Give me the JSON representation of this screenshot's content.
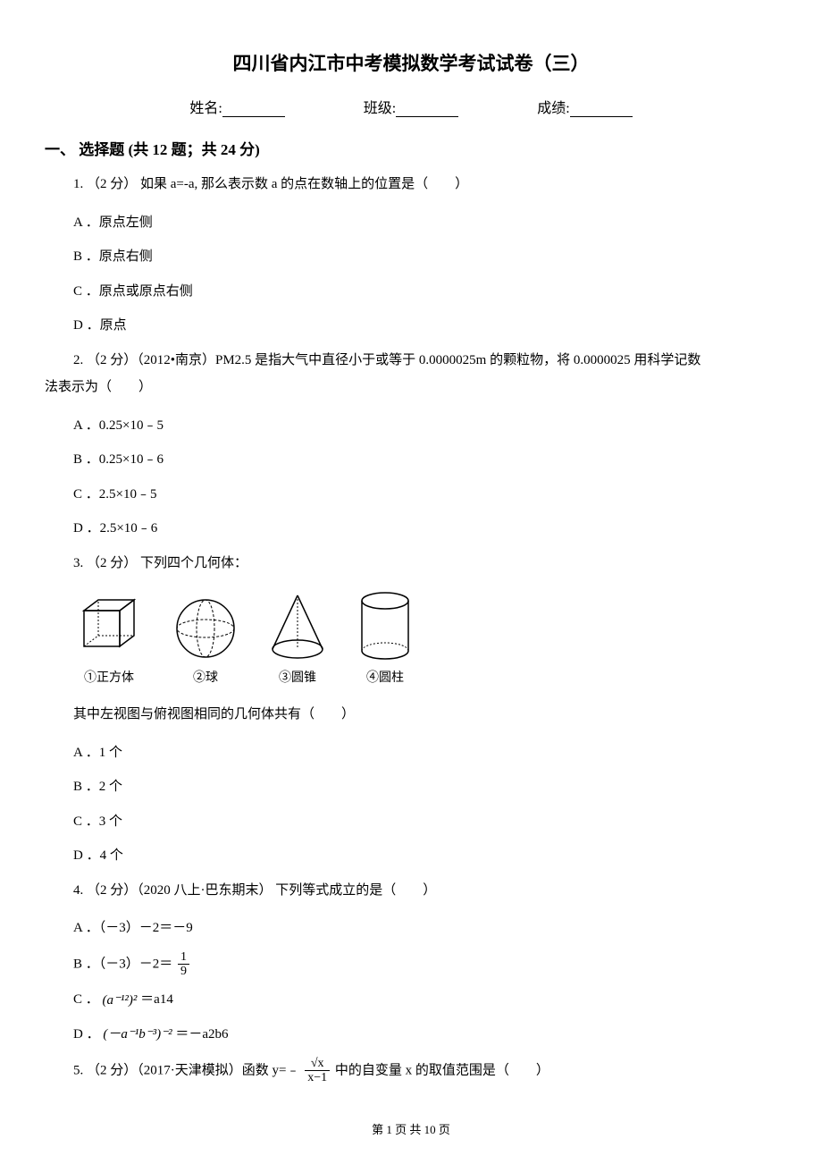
{
  "title": "四川省内江市中考模拟数学考试试卷（三）",
  "info": {
    "name_label": "姓名:",
    "class_label": "班级:",
    "score_label": "成绩:"
  },
  "section1": {
    "header": "一、 选择题 (共 12 题；共 24 分)"
  },
  "q1": {
    "stem": "1.  （2 分） 如果 a=-a, 那么表示数 a 的点在数轴上的位置是（　　）",
    "a": "A ．原点左侧",
    "b": "B ．原点右侧",
    "c": "C ．原点或原点右侧",
    "d": "D ．原点"
  },
  "q2": {
    "stem": "2.  （2 分）（2012•南京）PM2.5 是指大气中直径小于或等于 0.0000025m 的颗粒物，将 0.0000025 用科学记数",
    "stem2": "法表示为（　　）",
    "a": "A ．0.25×10﹣5",
    "b": "B ．0.25×10﹣6",
    "c": "C ．2.5×10﹣5",
    "d": "D ．2.5×10﹣6"
  },
  "q3": {
    "stem": "3.  （2 分） 下列四个几何体：",
    "shapes": {
      "s1": "①正方体",
      "s2": "②球",
      "s3": "③圆锥",
      "s4": "④圆柱"
    },
    "stem2": "其中左视图与俯视图相同的几何体共有（　　）",
    "a": "A ．1 个",
    "b": "B ．2 个",
    "c": "C ．3 个",
    "d": "D ．4 个"
  },
  "q4": {
    "stem": "4.  （2 分）（2020 八上·巴东期末） 下列等式成立的是（　　）",
    "a_pre": "A ．（－3）－2＝－9",
    "b_pre": "B ．（－3）－2＝",
    "b_frac_num": "1",
    "b_frac_den": "9",
    "c_pre": "C ．",
    "c_expr": "(a⁻¹²)²",
    "c_post": " ＝a14",
    "d_pre": "D ．",
    "d_expr": "(－a⁻¹b⁻³)⁻²",
    "d_post": " ＝－a2b6"
  },
  "q5": {
    "stem_pre": "5.  （2 分）（2017·天津模拟）函数 y=﹣ ",
    "frac_num": "√x",
    "frac_den": "x−1",
    "stem_post": " 中的自变量 x 的取值范围是（　　）"
  },
  "footer": "第 1 页 共 10 页"
}
